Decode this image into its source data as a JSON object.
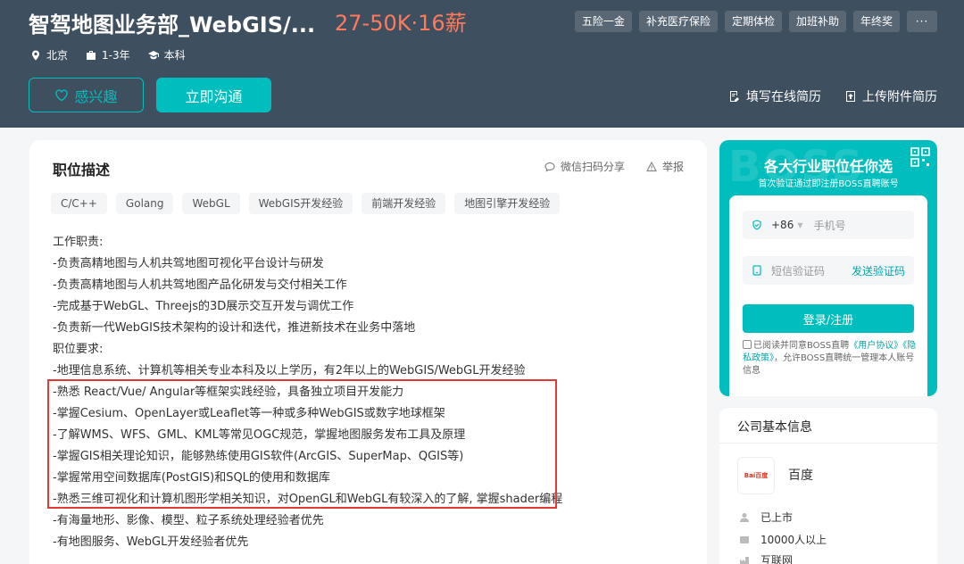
{
  "header": {
    "job_title": "智驾地图业务部_WebGIS/...",
    "salary": "27-50K·16薪",
    "benefits": [
      "五险一金",
      "补充医疗保险",
      "定期体检",
      "加班补助",
      "年终奖",
      "···"
    ],
    "meta": {
      "location": "北京",
      "experience": "1-3年",
      "education": "本科"
    },
    "interest_label": "感兴趣",
    "chat_label": "立即沟通",
    "fill_resume_label": "填写在线简历",
    "upload_resume_label": "上传附件简历"
  },
  "job": {
    "section_title": "职位描述",
    "share_label": "微信扫码分享",
    "report_label": "举报",
    "tags": [
      "C/C++",
      "Golang",
      "WebGL",
      "WebGIS开发经验",
      "前端开发经验",
      "地图引擎开发经验"
    ],
    "lines": [
      "工作职责:",
      "-负责高精地图与人机共驾地图可视化平台设计与研发",
      "-负责高精地图与人机共驾地图产品化研发与交付相关工作",
      "-完成基于WebGL、Threejs的3D展示交互开发与调优工作",
      "-负责新一代WebGIS技术架构的设计和迭代，推进新技术在业务中落地",
      "职位要求:",
      "-地理信息系统、计算机等相关专业本科及以上学历，有2年以上的WebGIS/WebGL开发经验",
      "-熟悉 React/Vue/ Angular等框架实践经验，具备独立项目开发能力",
      "-掌握Cesium、OpenLayer或Leaflet等一种或多种WebGIS或数字地球框架",
      "-了解WMS、WFS、GML、KML等常见OGC规范，掌握地图服务发布工具及原理",
      "-掌握GIS相关理论知识，能够熟练使用GIS软件(ArcGIS、SuperMap、QGIS等)",
      "-掌握常用空间数据库(PostGIS)和SQL的使用和数据库",
      "-熟悉三维可视化和计算机图形学相关知识，对OpenGL和WebGL有较深入的了解, 掌握shader编程",
      "-有海量地形、影像、模型、粒子系统处理经验者优先",
      "-有地图服务、WebGL开发经验者优先"
    ]
  },
  "login": {
    "watermark": "BOSS",
    "title": "各大行业职位任你选",
    "subtitle": "首次验证通过即注册BOSS直聘账号",
    "country_code": "+86",
    "phone_placeholder": "手机号",
    "code_placeholder": "短信验证码",
    "send_code_label": "发送验证码",
    "login_button": "登录/注册",
    "agree_prefix": "已阅读并同意BOSS直聘",
    "agree_link1": "《用户协议》",
    "agree_link2": "《隐私政策》",
    "agree_suffix": "，允许BOSS直聘统一管理本人账号信息"
  },
  "company": {
    "section_title": "公司基本信息",
    "logo_text": "Bai百度",
    "name": "百度",
    "stage": "已上市",
    "size": "10000人以上",
    "industry": "互联网"
  },
  "colors": {
    "header_bg": "#3e4f5f",
    "accent": "#00bebd",
    "salary": "#ff7a5a",
    "highlight": "#e53935"
  }
}
